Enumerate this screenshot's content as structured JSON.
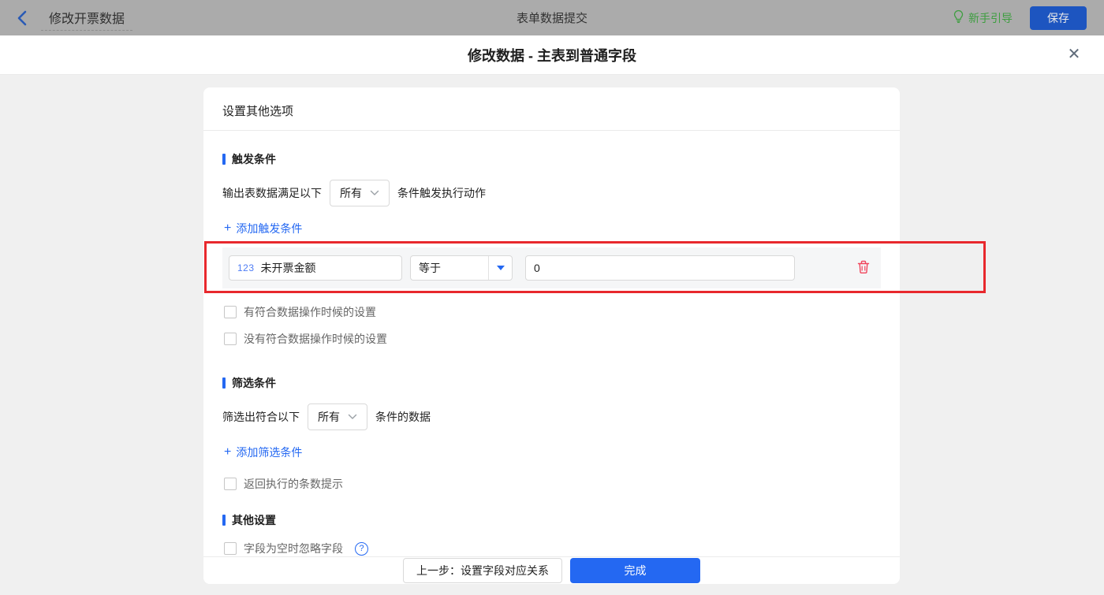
{
  "topbar": {
    "back_label": "修改开票数据",
    "center_title": "表单数据提交",
    "guide_label": "新手引导",
    "save_label": "保存"
  },
  "dialog": {
    "title": "修改数据 - 主表到普通字段"
  },
  "card": {
    "header": "设置其他选项",
    "trigger": {
      "section_title": "触发条件",
      "sentence_prefix": "输出表数据满足以下",
      "match_value": "所有",
      "sentence_suffix": "条件触发执行动作",
      "add_label": "添加触发条件",
      "condition": {
        "field_tag": "123",
        "field_name": "未开票金额",
        "operator": "等于",
        "value": "0"
      },
      "checkbox_has_match": "有符合数据操作时候的设置",
      "checkbox_no_match": "没有符合数据操作时候的设置"
    },
    "filter": {
      "section_title": "筛选条件",
      "sentence_prefix": "筛选出符合以下",
      "match_value": "所有",
      "sentence_suffix": "条件的数据",
      "add_label": "添加筛选条件",
      "checkbox_count_hint": "返回执行的条数提示"
    },
    "other": {
      "section_title": "其他设置",
      "checkbox_ignore_empty": "字段为空时忽略字段"
    },
    "footer": {
      "prev_label": "上一步：设置字段对应关系",
      "done_label": "完成"
    }
  },
  "icons": {
    "back": "chevron-left",
    "guide": "lightbulb",
    "close": "✕",
    "match_caret": "chevron-down",
    "operator_caret": "triangle-down",
    "plus": "+",
    "delete": "trash",
    "help": "?"
  },
  "colors": {
    "accent_blue": "#2468f2",
    "topbar_gray": "#ababab",
    "guide_green": "#3e9e40",
    "annotation_red": "#e8282d",
    "danger_red": "#f0455c"
  }
}
